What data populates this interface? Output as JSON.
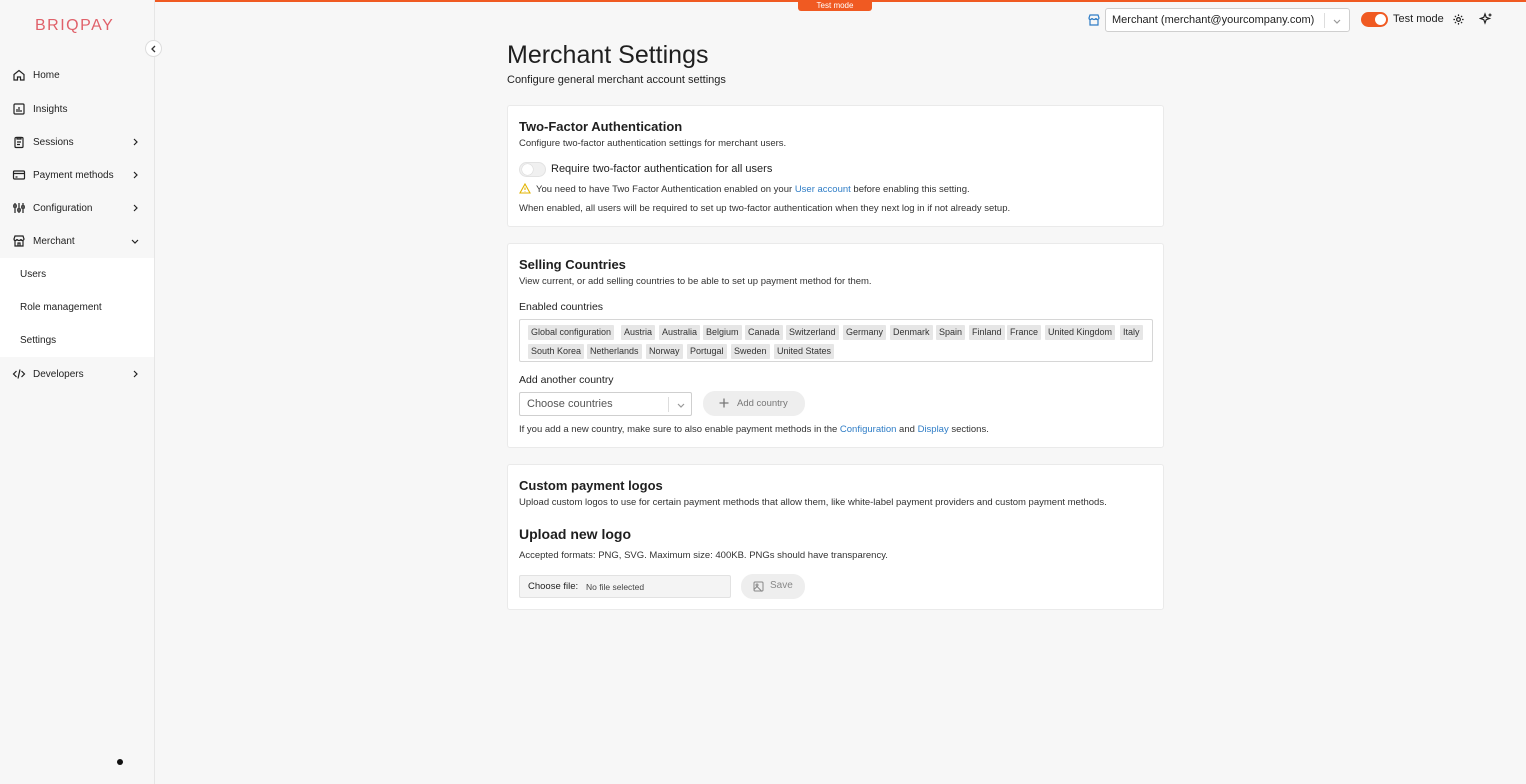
{
  "banner": {
    "test_mode": "Test mode"
  },
  "sidebar": {
    "logo": "BRIQPAY",
    "items": [
      {
        "label": "Home"
      },
      {
        "label": "Insights"
      },
      {
        "label": "Sessions"
      },
      {
        "label": "Payment methods"
      },
      {
        "label": "Configuration"
      },
      {
        "label": "Merchant"
      },
      {
        "label": "Developers"
      }
    ],
    "sub_items": [
      {
        "label": "Users"
      },
      {
        "label": "Role management"
      },
      {
        "label": "Settings"
      }
    ]
  },
  "header": {
    "merchant_value": "Merchant (merchant@yourcompany.com)",
    "test_mode_label": "Test mode",
    "test_mode_on": true
  },
  "main": {
    "title": "Merchant Settings",
    "subtitle": "Configure general merchant account settings"
  },
  "twofa": {
    "title": "Two-Factor Authentication",
    "desc": "Configure two-factor authentication settings for merchant users.",
    "toggle_label": "Require two-factor authentication for all users",
    "warning_pre": "You need to have Two Factor Authentication enabled on your ",
    "warning_link": "User account",
    "warning_post": " before enabling this setting.",
    "note": "When enabled, all users will be required to set up two-factor authentication when they next log in if not already setup."
  },
  "countries": {
    "title": "Selling Countries",
    "desc": "View current, or add selling countries to be able to set up payment method for them.",
    "enabled_label": "Enabled countries",
    "enabled": [
      "Global configuration",
      "Austria",
      "Australia",
      "Belgium",
      "Canada",
      "Switzerland",
      "Germany",
      "Denmark",
      "Spain",
      "Finland",
      "France",
      "United Kingdom",
      "Italy",
      "South Korea",
      "Netherlands",
      "Norway",
      "Portugal",
      "Sweden",
      "United States"
    ],
    "add_label": "Add another country",
    "select_placeholder": "Choose countries",
    "add_button": "Add country",
    "note_pre": "If you add a new country, make sure to also enable payment methods in the ",
    "note_link1": "Configuration",
    "note_mid": " and ",
    "note_link2": "Display",
    "note_post": " sections."
  },
  "logos": {
    "title": "Custom payment logos",
    "desc": "Upload custom logos to use for certain payment methods that allow them, like white-label payment providers and custom payment methods.",
    "upload_title": "Upload new logo",
    "formats": "Accepted formats: PNG, SVG. Maximum size: 400KB. PNGs should have transparency.",
    "file_button": "Choose file:",
    "file_status": "No file selected",
    "save_button": "Save"
  },
  "colors": {
    "accent": "#f05a22",
    "logo": "#e0616a",
    "link": "#2f7dc6"
  }
}
